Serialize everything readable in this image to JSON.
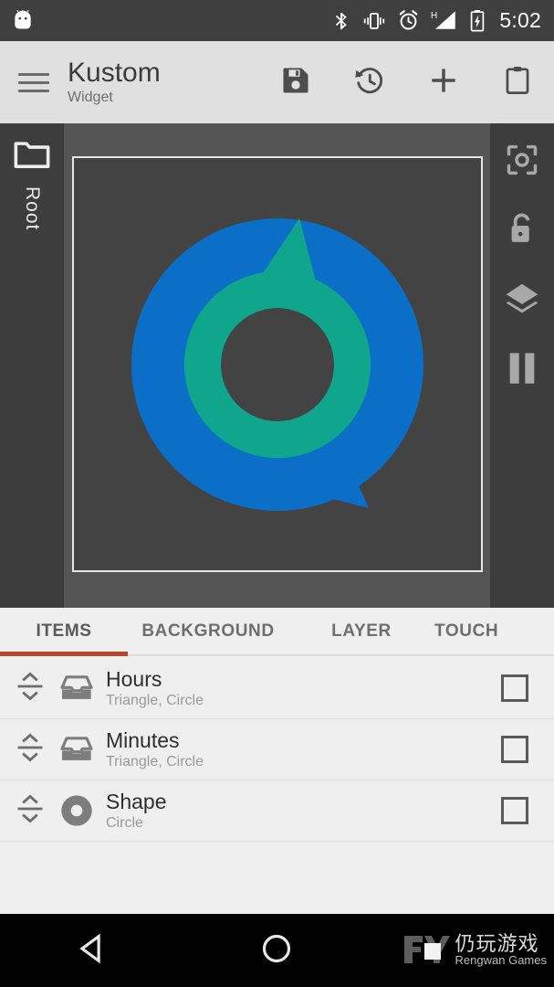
{
  "status_bar": {
    "notification_icon": "android-mascot-icon",
    "icons": [
      "bluetooth-icon",
      "vibrate-icon",
      "alarm-icon",
      "signal-icon",
      "battery-charging-icon"
    ],
    "network_type": "H",
    "time": "5:02",
    "background_color": "#3f3f3f"
  },
  "app_bar": {
    "menu_icon": "hamburger-menu-icon",
    "title": "Kustom",
    "subtitle": "Widget",
    "actions": [
      {
        "name": "save-button",
        "icon": "save-floppy-icon"
      },
      {
        "name": "history-button",
        "icon": "history-clock-icon"
      },
      {
        "name": "add-button",
        "icon": "plus-icon"
      },
      {
        "name": "clipboard-button",
        "icon": "clipboard-icon"
      }
    ],
    "background_color": "#e0e0e0"
  },
  "preview": {
    "left_rail": {
      "icon": "folder-icon",
      "label": "Root"
    },
    "right_rail": [
      {
        "name": "screenshot-button",
        "icon": "center-focus-icon"
      },
      {
        "name": "lock-button",
        "icon": "unlock-icon"
      },
      {
        "name": "layers-button",
        "icon": "layers-icon"
      },
      {
        "name": "pause-button",
        "icon": "pause-icon"
      }
    ],
    "canvas": {
      "background_color": "#434343",
      "border_color": "#e6e6e6",
      "shapes": [
        {
          "name": "hours-ring",
          "type": "circle-ring",
          "color": "#0b6fc8",
          "pointer": "triangle",
          "pointer_angle_deg": 130
        },
        {
          "name": "minutes-ring",
          "type": "circle-ring",
          "color": "#10a68d",
          "pointer": "triangle",
          "pointer_angle_deg": 0
        }
      ]
    }
  },
  "tabs": {
    "items": [
      {
        "label": "ITEMS",
        "active": true
      },
      {
        "label": "BACKGROUND",
        "active": false
      },
      {
        "label": "LAYER",
        "active": false
      },
      {
        "label": "TOUCH",
        "active": false
      }
    ],
    "indicator_color": "#b8472a"
  },
  "items_list": {
    "rows": [
      {
        "title": "Hours",
        "subtitle": "Triangle, Circle",
        "icon": "group-inbox-icon",
        "checked": false
      },
      {
        "title": "Minutes",
        "subtitle": "Triangle, Circle",
        "icon": "group-inbox-icon",
        "checked": false
      },
      {
        "title": "Shape",
        "subtitle": "Circle",
        "icon": "donut-shape-icon",
        "checked": false
      }
    ]
  },
  "nav_bar": {
    "buttons": [
      {
        "name": "back-button",
        "icon": "back-triangle-icon"
      },
      {
        "name": "home-button",
        "icon": "home-circle-icon"
      },
      {
        "name": "recents-button",
        "icon": "recents-icon"
      }
    ],
    "watermark": {
      "cn": "仍玩游戏",
      "en": "Rengwan Games"
    }
  }
}
